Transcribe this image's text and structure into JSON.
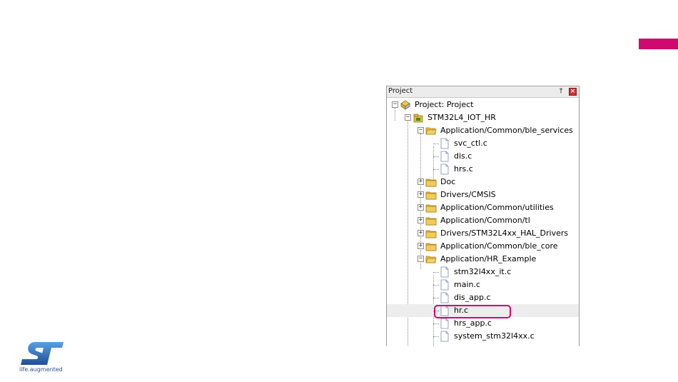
{
  "colors": {
    "accent": "#d1086f",
    "brand_blue": "#2d4f8c",
    "folder": "#e8b93a"
  },
  "panel": {
    "title": "Project",
    "pin_glyph": "†",
    "close_glyph": "×"
  },
  "tree": [
    {
      "label": "Project: Project",
      "type": "project",
      "state": "expanded"
    },
    {
      "label": "STM32L4_IOT_HR",
      "type": "target",
      "state": "expanded"
    },
    {
      "label": "Application/Common/ble_services",
      "type": "folder-open",
      "state": "expanded"
    },
    {
      "label": "svc_ctl.c",
      "type": "file"
    },
    {
      "label": "dis.c",
      "type": "file"
    },
    {
      "label": "hrs.c",
      "type": "file"
    },
    {
      "label": "Doc",
      "type": "folder",
      "state": "collapsed"
    },
    {
      "label": "Drivers/CMSIS",
      "type": "folder",
      "state": "collapsed"
    },
    {
      "label": "Application/Common/utilities",
      "type": "folder",
      "state": "collapsed"
    },
    {
      "label": "Application/Common/tl",
      "type": "folder",
      "state": "collapsed"
    },
    {
      "label": "Drivers/STM32L4xx_HAL_Drivers",
      "type": "folder",
      "state": "collapsed"
    },
    {
      "label": "Application/Common/ble_core",
      "type": "folder",
      "state": "collapsed"
    },
    {
      "label": "Application/HR_Example",
      "type": "folder-open",
      "state": "expanded"
    },
    {
      "label": "stm32l4xx_it.c",
      "type": "file"
    },
    {
      "label": "main.c",
      "type": "file"
    },
    {
      "label": "dis_app.c",
      "type": "file"
    },
    {
      "label": "hr.c",
      "type": "file",
      "selected": true
    },
    {
      "label": "hrs_app.c",
      "type": "file"
    },
    {
      "label": "system_stm32l4xx.c",
      "type": "file"
    }
  ],
  "logo": {
    "tagline": "life.augmented"
  }
}
